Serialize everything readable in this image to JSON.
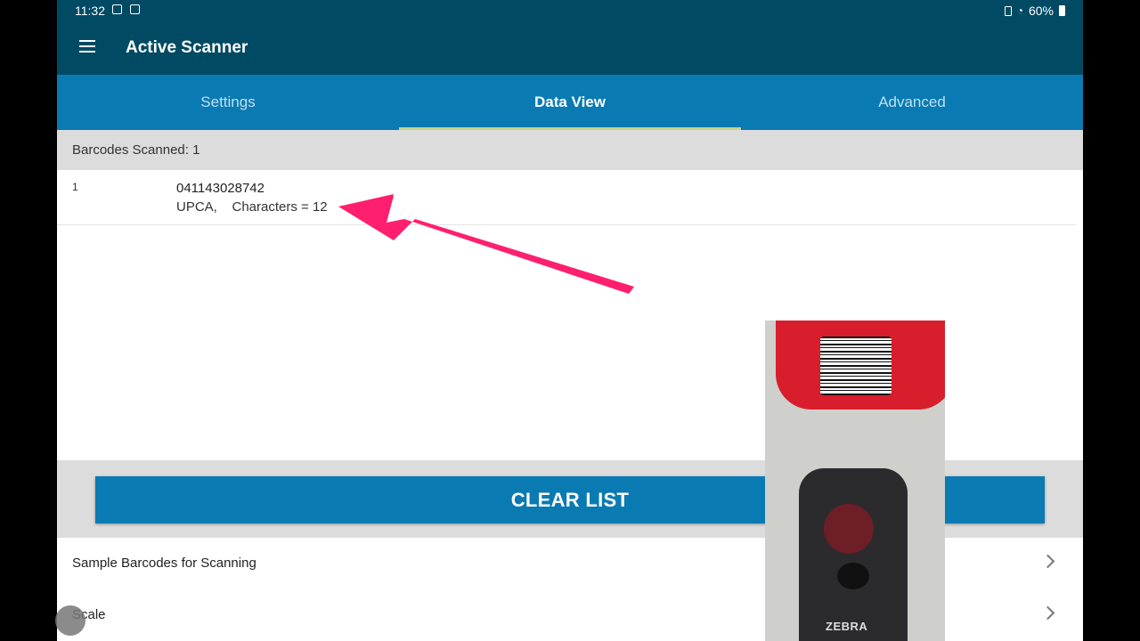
{
  "status_bar": {
    "time": "11:32",
    "battery": "60%"
  },
  "app_bar": {
    "title": "Active Scanner"
  },
  "tabs": [
    {
      "label": "Settings"
    },
    {
      "label": "Data View"
    },
    {
      "label": "Advanced"
    }
  ],
  "count_bar": {
    "text": "Barcodes Scanned: 1"
  },
  "scans": [
    {
      "index": "1",
      "barcode": "041143028742",
      "meta": "UPCA,    Characters = 12"
    }
  ],
  "clear_button": {
    "label": "CLEAR LIST"
  },
  "menu_rows": [
    {
      "label": "Sample Barcodes for Scanning"
    },
    {
      "label": "Scale"
    }
  ],
  "video_overlay": {
    "brand": "ZEBRA"
  },
  "colors": {
    "app_bar": "#004a63",
    "tab_bar": "#0a7ab3",
    "tab_indicator": "#c7d38a",
    "annotation_arrow": "#ff1f6e"
  }
}
